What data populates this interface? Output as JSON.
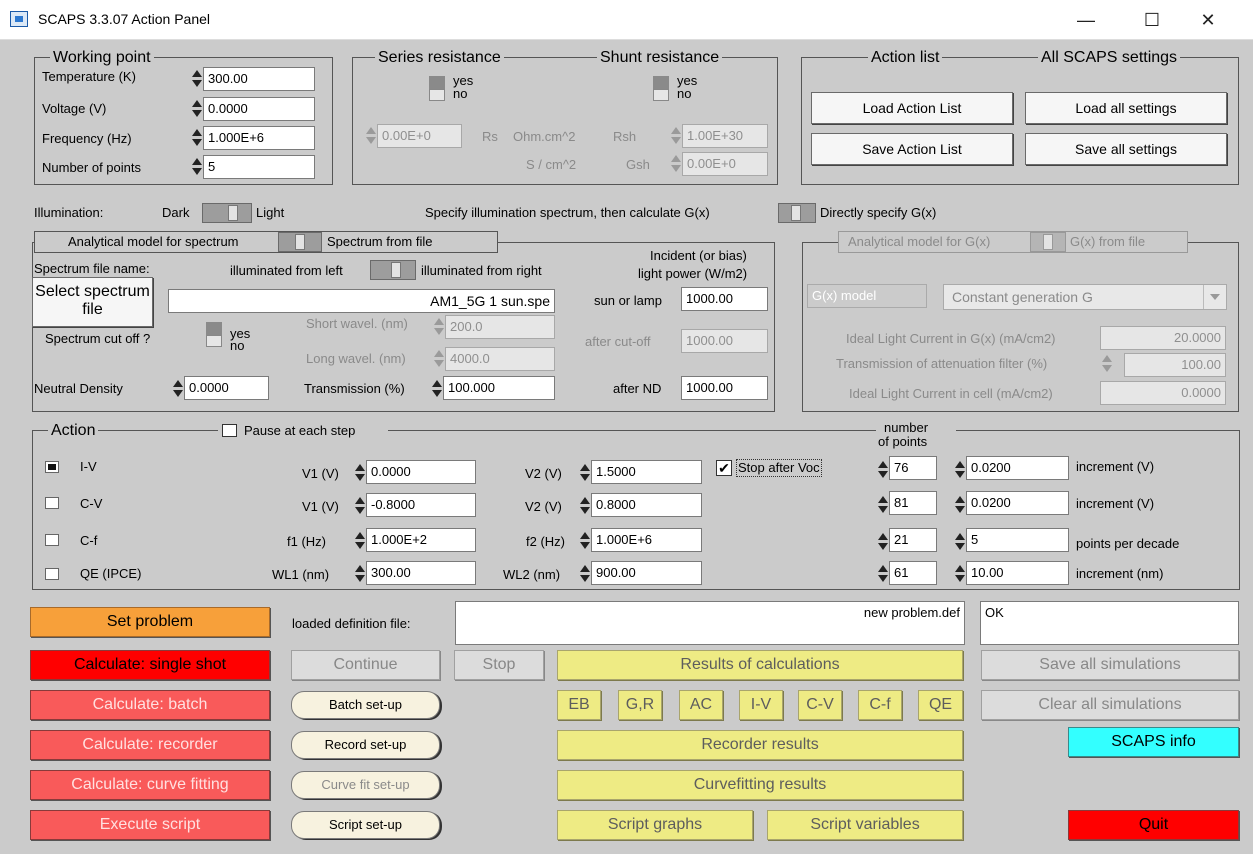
{
  "window": {
    "title": "SCAPS 3.3.07 Action Panel",
    "minimize": "—",
    "maximize": "☐",
    "close": "✕"
  },
  "working_point": {
    "title": "Working point",
    "temperature_label": "Temperature (K)",
    "temperature": "300.00",
    "voltage_label": "Voltage (V)",
    "voltage": "0.0000",
    "frequency_label": "Frequency (Hz)",
    "frequency": "1.000E+6",
    "points_label": "Number of points",
    "points": "5"
  },
  "resistance": {
    "series_title": "Series resistance",
    "shunt_title": "Shunt resistance",
    "yes": "yes",
    "no": "no",
    "rs_value": "0.00E+0",
    "rs_label": "Rs",
    "rs_unit": "Ohm.cm^2",
    "rsh_label": "Rsh",
    "rsh_value": "1.00E+30",
    "g_unit": "S / cm^2",
    "gsh_label": "Gsh",
    "gsh_value": "0.00E+0"
  },
  "action_list": {
    "title": "Action list",
    "settings_title": "All SCAPS settings",
    "load_action": "Load Action List",
    "save_action": "Save Action List",
    "load_all": "Load all settings",
    "save_all": "Save all settings"
  },
  "illumination": {
    "label": "Illumination:",
    "dark": "Dark",
    "light": "Light",
    "specify_spectrum": "Specify illumination spectrum, then calculate G(x)",
    "direct_gx": "Directly specify G(x)"
  },
  "spectrum": {
    "tab_analytical": "Analytical model for spectrum",
    "tab_file": "Spectrum from file",
    "file_name_label": "Spectrum file name:",
    "illum_left": "illuminated from left",
    "illum_right": "illuminated from right",
    "incident_label": "Incident (or bias)",
    "power_label": "light power (W/m2)",
    "select_button": "Select spectrum file",
    "file_value": "AM1_5G 1 sun.spe",
    "sun_label": "sun or lamp",
    "sun_value": "1000.00",
    "cutoff_label": "Spectrum cut off ?",
    "yes": "yes",
    "no": "no",
    "short_label": "Short wavel. (nm)",
    "short_value": "200.0",
    "long_label": "Long wavel. (nm)",
    "long_value": "4000.0",
    "after_cutoff_label": "after cut-off",
    "after_cutoff_value": "1000.00",
    "nd_label": "Neutral Density",
    "nd_value": "0.0000",
    "trans_label": "Transmission (%)",
    "trans_value": "100.000",
    "after_nd_label": "after ND",
    "after_nd_value": "1000.00"
  },
  "gx": {
    "tab_analytical": "Analytical model for G(x)",
    "tab_file": "G(x) from file",
    "model_label": "G(x) model",
    "model_value": "Constant generation G",
    "ideal_label": "Ideal Light Current in G(x) (mA/cm2)",
    "ideal_value": "20.0000",
    "atten_label": "Transmission of attenuation filter (%)",
    "atten_value": "100.00",
    "cell_label": "Ideal Light Current in cell (mA/cm2)",
    "cell_value": "0.0000"
  },
  "action": {
    "title": "Action",
    "pause": "Pause at each step",
    "number_of_points_1": "number",
    "number_of_points_2": "of points",
    "stop_voc": "Stop after Voc",
    "stop_voc_check": "✔",
    "rows": [
      {
        "name": "I-V",
        "p1_label": "V1 (V)",
        "p1": "0.0000",
        "p2_label": "V2 (V)",
        "p2": "1.5000",
        "n": "76",
        "inc": "0.0200",
        "inc_label": "increment (V)"
      },
      {
        "name": "C-V",
        "p1_label": "V1 (V)",
        "p1": "-0.8000",
        "p2_label": "V2 (V)",
        "p2": "0.8000",
        "n": "81",
        "inc": "0.0200",
        "inc_label": "increment (V)"
      },
      {
        "name": "C-f",
        "p1_label": "f1 (Hz)",
        "p1": "1.000E+2",
        "p2_label": "f2 (Hz)",
        "p2": "1.000E+6",
        "n": "21",
        "inc": "5",
        "inc_label": "points per decade"
      },
      {
        "name": "QE (IPCE)",
        "p1_label": "WL1 (nm)",
        "p1": "300.00",
        "p2_label": "WL2 (nm)",
        "p2": "900.00",
        "n": "61",
        "inc": "10.00",
        "inc_label": "increment (nm)"
      }
    ]
  },
  "bottom": {
    "set_problem": "Set problem",
    "loaded_def_label": "loaded definition file:",
    "def_file": "new problem.def",
    "status": "OK",
    "calc_single": "Calculate: single shot",
    "calc_batch": "Calculate: batch",
    "calc_recorder": "Calculate: recorder",
    "calc_fit": "Calculate: curve fitting",
    "exec_script": "Execute script",
    "continue": "Continue",
    "stop": "Stop",
    "batch_setup": "Batch set-up",
    "record_setup": "Record set-up",
    "fit_setup": "Curve fit set-up",
    "script_setup": "Script set-up",
    "results": "Results of calculations",
    "small_buttons": [
      "EB",
      "G,R",
      "AC",
      "I-V",
      "C-V",
      "C-f",
      "QE"
    ],
    "recorder_results": "Recorder results",
    "curvefit_results": "Curvefitting results",
    "script_graphs": "Script graphs",
    "script_variables": "Script variables",
    "save_sims": "Save all simulations",
    "clear_sims": "Clear all simulations",
    "scaps_info": "SCAPS info",
    "quit": "Quit"
  },
  "colors": {
    "orange": "#f7a03a",
    "red": "#ff0000",
    "light_red": "#f95a5a",
    "yellow": "#eeeb84",
    "cyan": "#33ffff"
  }
}
